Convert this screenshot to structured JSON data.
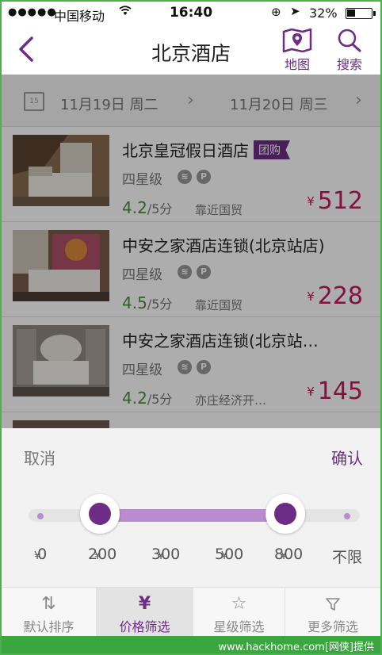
{
  "status_bar": {
    "carrier": "中国移动",
    "time": "16:40",
    "battery": "32%"
  },
  "nav": {
    "title": "北京酒店",
    "map_label": "地图",
    "search_label": "搜索"
  },
  "dates": {
    "checkin": "11月19日  周二",
    "checkout": "11月20日  周三",
    "calendar_day": "15"
  },
  "hotels": [
    {
      "name": "北京皇冠假日酒店",
      "tag": "团购",
      "star": "四星级",
      "rating": "4.2",
      "rating_suffix": "/5分",
      "area": "靠近国贸",
      "currency": "¥",
      "price": "512"
    },
    {
      "name": "中安之家酒店连锁(北京站店)",
      "star": "四星级",
      "rating": "4.5",
      "rating_suffix": "/5分",
      "area": "靠近国贸",
      "currency": "¥",
      "price": "228"
    },
    {
      "name": "中安之家酒店连锁(北京站…",
      "star": "四星级",
      "rating": "4.2",
      "rating_suffix": "/5分",
      "area": "亦庄经济开…",
      "currency": "¥",
      "price": "145"
    }
  ],
  "filter": {
    "cancel_label": "取消",
    "confirm_label": "确认",
    "range_min_label": "¥200",
    "range_max_label": "¥800",
    "ticks": [
      {
        "cur": "¥",
        "val": "0"
      },
      {
        "cur": "¥",
        "val": "200"
      },
      {
        "cur": "¥",
        "val": "300"
      },
      {
        "cur": "¥",
        "val": "500"
      },
      {
        "cur": "¥",
        "val": "800"
      },
      {
        "cur": "",
        "val": "不限"
      }
    ]
  },
  "tabs": [
    {
      "label": "默认排序",
      "icon": "sort-icon"
    },
    {
      "label": "价格筛选",
      "icon": "yen-icon"
    },
    {
      "label": "星级筛选",
      "icon": "star-icon"
    },
    {
      "label": "更多筛选",
      "icon": "filter-icon"
    }
  ],
  "watermark": "www.hackhome.com[网侠]提供",
  "colors": {
    "accent": "#6d2c86",
    "price": "#c2185b",
    "rating": "#4a8d3c",
    "slider_range": "#b98cd0"
  }
}
